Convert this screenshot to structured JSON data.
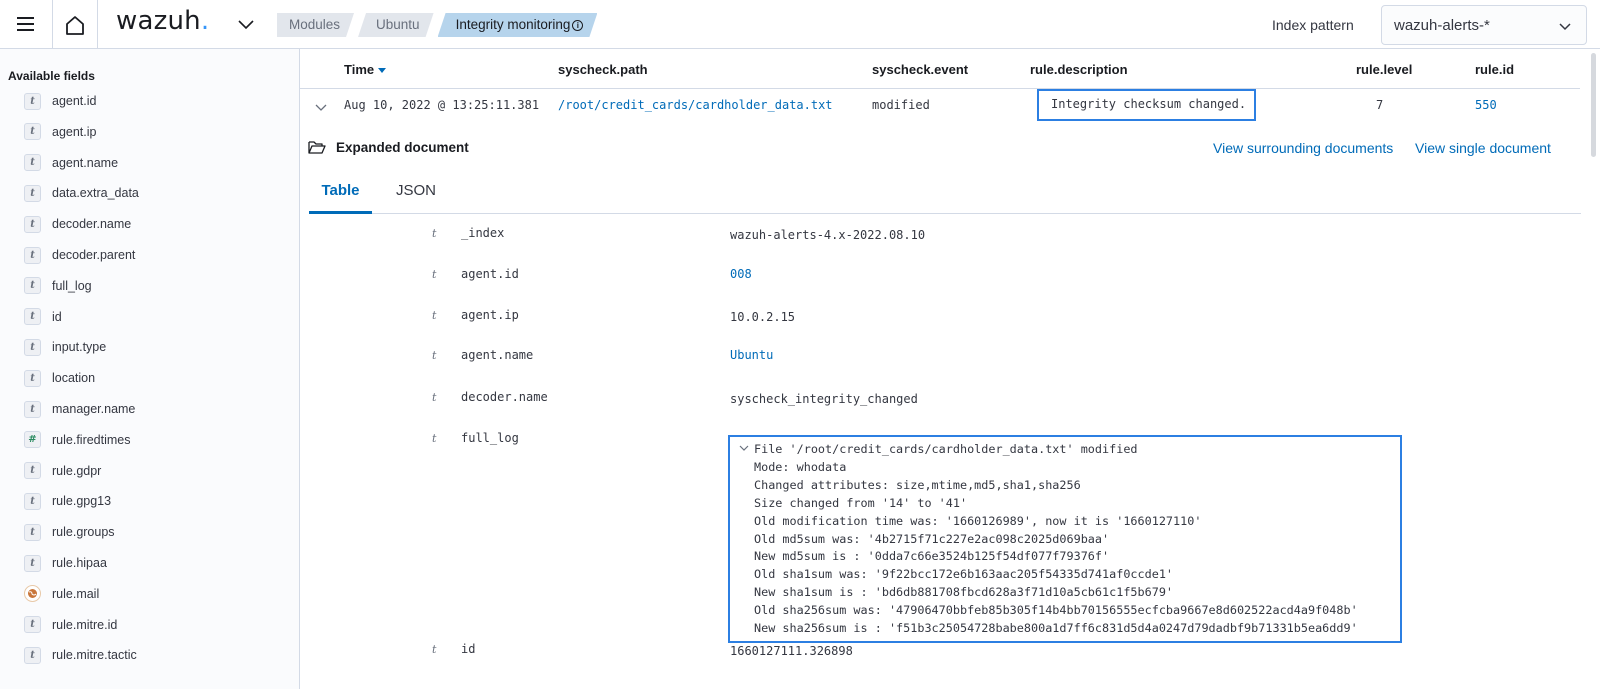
{
  "header": {
    "logo_text": "wazuh",
    "logo_dot": ".",
    "breadcrumbs": [
      "Modules",
      "Ubuntu",
      "Integrity monitoring"
    ],
    "breadcrumb_info": "i",
    "index_pattern_label": "Index pattern",
    "index_pattern_value": "wazuh-alerts-*"
  },
  "sidebar": {
    "title": "Available fields",
    "fields": [
      {
        "type": "t",
        "name": "agent.id"
      },
      {
        "type": "t",
        "name": "agent.ip"
      },
      {
        "type": "t",
        "name": "agent.name"
      },
      {
        "type": "t",
        "name": "data.extra_data"
      },
      {
        "type": "t",
        "name": "decoder.name"
      },
      {
        "type": "t",
        "name": "decoder.parent"
      },
      {
        "type": "t",
        "name": "full_log"
      },
      {
        "type": "t",
        "name": "id"
      },
      {
        "type": "t",
        "name": "input.type"
      },
      {
        "type": "t",
        "name": "location"
      },
      {
        "type": "t",
        "name": "manager.name"
      },
      {
        "type": "#",
        "name": "rule.firedtimes"
      },
      {
        "type": "t",
        "name": "rule.gdpr"
      },
      {
        "type": "t",
        "name": "rule.gpg13"
      },
      {
        "type": "t",
        "name": "rule.groups"
      },
      {
        "type": "t",
        "name": "rule.hipaa"
      },
      {
        "type": "geo",
        "name": "rule.mail"
      },
      {
        "type": "t",
        "name": "rule.mitre.id"
      },
      {
        "type": "t",
        "name": "rule.mitre.tactic"
      }
    ]
  },
  "table": {
    "columns": [
      "Time",
      "syscheck.path",
      "syscheck.event",
      "rule.description",
      "rule.level",
      "rule.id"
    ],
    "row": {
      "time": "Aug 10, 2022 @ 13:25:11.381",
      "path": "/root/credit_cards/cardholder_data.txt",
      "event": "modified",
      "description": "Integrity checksum changed.",
      "level": "7",
      "id": "550"
    }
  },
  "expanded": {
    "label": "Expanded document",
    "view_surrounding": "View surrounding documents",
    "view_single": "View single document",
    "tabs": [
      "Table",
      "JSON"
    ],
    "fields": [
      {
        "type": "t",
        "key": "_index",
        "value": "wazuh-alerts-4.x-2022.08.10"
      },
      {
        "type": "t",
        "key": "agent.id",
        "value": "008"
      },
      {
        "type": "t",
        "key": "agent.ip",
        "value": "10.0.2.15"
      },
      {
        "type": "t",
        "key": "agent.name",
        "value": "Ubuntu"
      },
      {
        "type": "t",
        "key": "decoder.name",
        "value": "syscheck_integrity_changed"
      },
      {
        "type": "t",
        "key": "full_log",
        "value": ""
      },
      {
        "type": "t",
        "key": "id",
        "value": "1660127111.326898"
      }
    ],
    "full_log": [
      "File '/root/credit_cards/cardholder_data.txt' modified",
      "Mode: whodata",
      "Changed attributes: size,mtime,md5,sha1,sha256",
      "Size changed from '14' to '41'",
      "Old modification time was: '1660126989', now it is '1660127110'",
      "Old md5sum was: '4b2715f71c227e2ac098c2025d069baa'",
      "New md5sum is : '0dda7c66e3524b125f54df077f79376f'",
      "Old sha1sum was: '9f22bcc172e6b163aac205f54335d741af0ccde1'",
      "New sha1sum is : 'bd6db881708fbcd628a3f71d10a5cb61c1f5b679'",
      "Old sha256sum was: '47906470bbfeb85b305f14b4bb70156555ecfcba9667e8d602522acd4a9f048b'",
      "New sha256sum is : 'f51b3c25054728babe800a1d7ff6c831d5d4a0247d79dadbf9b71331b5ea6dd9'"
    ]
  },
  "colors": {
    "accent": "#006bb8",
    "highlight_border": "#2c7fe2",
    "breadcrumb_active": "#b6d4ec",
    "logo_dot": "#3595f9"
  }
}
